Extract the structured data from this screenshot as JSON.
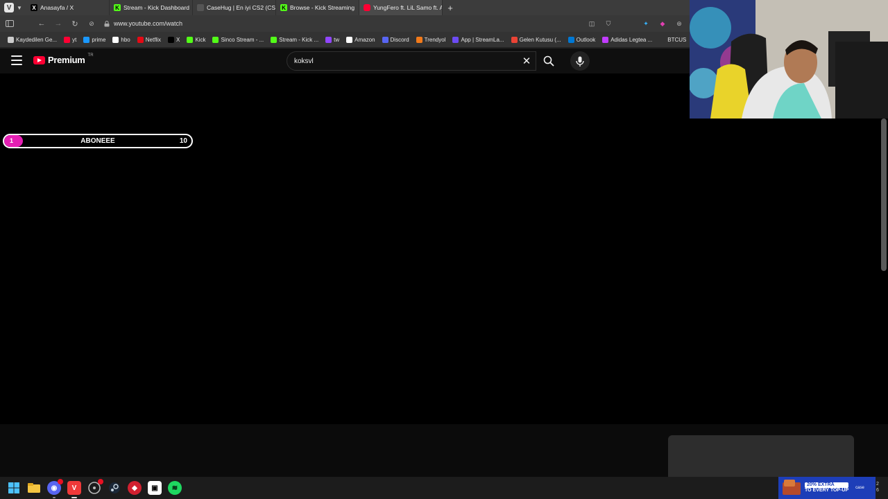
{
  "browser": {
    "tabs": [
      {
        "title": "Anasayfa / X",
        "icon": "x-icon",
        "active": false
      },
      {
        "title": "Stream - Kick Dashboard",
        "icon": "kick-icon",
        "active": false
      },
      {
        "title": "CaseHug | En iyi CS2 (CS:G",
        "icon": "casehug-icon",
        "active": false
      },
      {
        "title": "Browse - Kick Streaming",
        "icon": "kick-icon",
        "active": false
      },
      {
        "title": "YungFero ft. LiL Samo ft. A",
        "icon": "youtube-icon",
        "active": true
      }
    ],
    "new_tab": "+",
    "url": "www.youtube.com/watch",
    "bookmarks": [
      {
        "label": "Kaydedilen Ge...",
        "color": "#cccccc"
      },
      {
        "label": "yt",
        "color": "#ff0033"
      },
      {
        "label": "prime",
        "color": "#1a98ff"
      },
      {
        "label": "hbo",
        "color": "#ffffff"
      },
      {
        "label": "Netflix",
        "color": "#e50914"
      },
      {
        "label": "X",
        "color": "#000000"
      },
      {
        "label": "Kick",
        "color": "#53fc18"
      },
      {
        "label": "Sinco Stream - ...",
        "color": "#53fc18"
      },
      {
        "label": "Stream - Kick ...",
        "color": "#53fc18"
      },
      {
        "label": "tw",
        "color": "#9146ff"
      },
      {
        "label": "Amazon",
        "color": "#ffffff"
      },
      {
        "label": "Discord",
        "color": "#5865f2"
      },
      {
        "label": "Trendyol",
        "color": "#f27a1a"
      },
      {
        "label": "App | StreamLa...",
        "color": "#6c4bf3"
      },
      {
        "label": "Gelen Kutusu (...",
        "color": "#ea4335"
      },
      {
        "label": "Outlook",
        "color": "#0078d4"
      },
      {
        "label": "Adidas Legtea ...",
        "color": "#c13cff"
      },
      {
        "label": "BTCUS",
        "color": "#333333"
      }
    ]
  },
  "youtube": {
    "logo_text": "Premium",
    "country_code": "TR",
    "search_value": "koksvl"
  },
  "goal_bar": {
    "label": "ABONEEE",
    "current": "1",
    "max": "10",
    "fraction": 0.1,
    "fill_color": "#e61fb4"
  },
  "taskbar": {
    "apps": [
      "windows-start-icon",
      "file-explorer-icon",
      "discord-icon",
      "vivaldi-icon",
      "obs-icon",
      "steam-icon",
      "app-red-icon",
      "capcut-icon",
      "spotify-icon"
    ],
    "promo_line1": "20% EXTRA",
    "promo_line2": "TO EVERY TOP-UP",
    "promo_brand": "case",
    "tray_text": "2\n6"
  }
}
